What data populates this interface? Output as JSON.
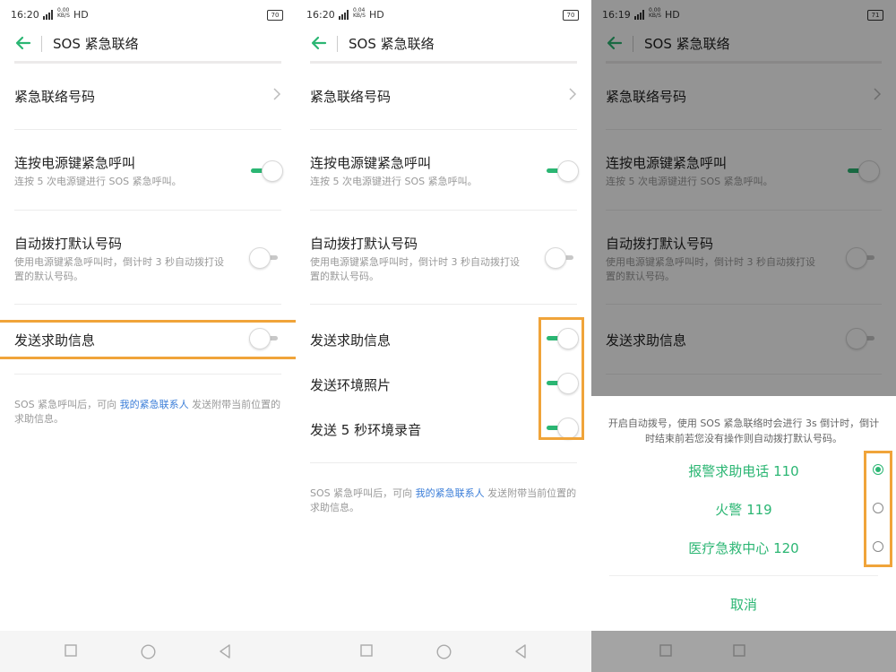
{
  "colors": {
    "accent": "#2bb673",
    "highlight": "#f0a43a",
    "link": "#3a7dd8"
  },
  "screens": [
    {
      "status": {
        "time": "16:20",
        "speed": "0.00\nKB/S",
        "network": "HD",
        "battery": "70"
      },
      "title": "SOS 紧急联络",
      "items": {
        "contacts": "紧急联络号码",
        "power": {
          "label": "连按电源键紧急呼叫",
          "desc": "连按 5 次电源键进行 SOS 紧急呼叫。",
          "on": true
        },
        "auto": {
          "label": "自动拨打默认号码",
          "desc": "使用电源键紧急呼叫时，倒计时 3 秒自动拨打设置的默认号码。",
          "on": false
        },
        "send": {
          "label": "发送求助信息",
          "on": false
        }
      },
      "footer": {
        "pre": "SOS 紧急呼叫后，可向 ",
        "link": "我的紧急联系人",
        "post": " 发送附带当前位置的求助信息。"
      }
    },
    {
      "status": {
        "time": "16:20",
        "speed": "0.04\nKB/S",
        "network": "HD",
        "battery": "70"
      },
      "title": "SOS 紧急联络",
      "items": {
        "contacts": "紧急联络号码",
        "power": {
          "label": "连按电源键紧急呼叫",
          "desc": "连按 5 次电源键进行 SOS 紧急呼叫。",
          "on": true
        },
        "auto": {
          "label": "自动拨打默认号码",
          "desc": "使用电源键紧急呼叫时，倒计时 3 秒自动拨打设置的默认号码。",
          "on": false
        },
        "send": {
          "label": "发送求助信息",
          "on": true
        },
        "photo": {
          "label": "发送环境照片",
          "on": true
        },
        "audio": {
          "label": "发送 5 秒环境录音",
          "on": true
        }
      },
      "footer": {
        "pre": "SOS 紧急呼叫后，可向 ",
        "link": "我的紧急联系人",
        "post": " 发送附带当前位置的求助信息。"
      }
    },
    {
      "status": {
        "time": "16:19",
        "speed": "0.00\nKB/S",
        "network": "HD",
        "battery": "71"
      },
      "title": "SOS 紧急联络",
      "items": {
        "contacts": "紧急联络号码",
        "power": {
          "label": "连按电源键紧急呼叫",
          "desc": "连按 5 次电源键进行 SOS 紧急呼叫。",
          "on": true
        },
        "auto": {
          "label": "自动拨打默认号码",
          "desc": "使用电源键紧急呼叫时，倒计时 3 秒自动拨打设置的默认号码。",
          "on": false
        },
        "send": {
          "label": "发送求助信息",
          "on": false
        }
      },
      "sheet": {
        "message": "开启自动拨号，使用 SOS 紧急联络时会进行 3s 倒计时，倒计时结束前若您没有操作则自动拨打默认号码。",
        "options": [
          {
            "label": "报警求助电话 110",
            "selected": true
          },
          {
            "label": "火警 119",
            "selected": false
          },
          {
            "label": "医疗急救中心 120",
            "selected": false
          }
        ],
        "cancel": "取消"
      }
    }
  ]
}
